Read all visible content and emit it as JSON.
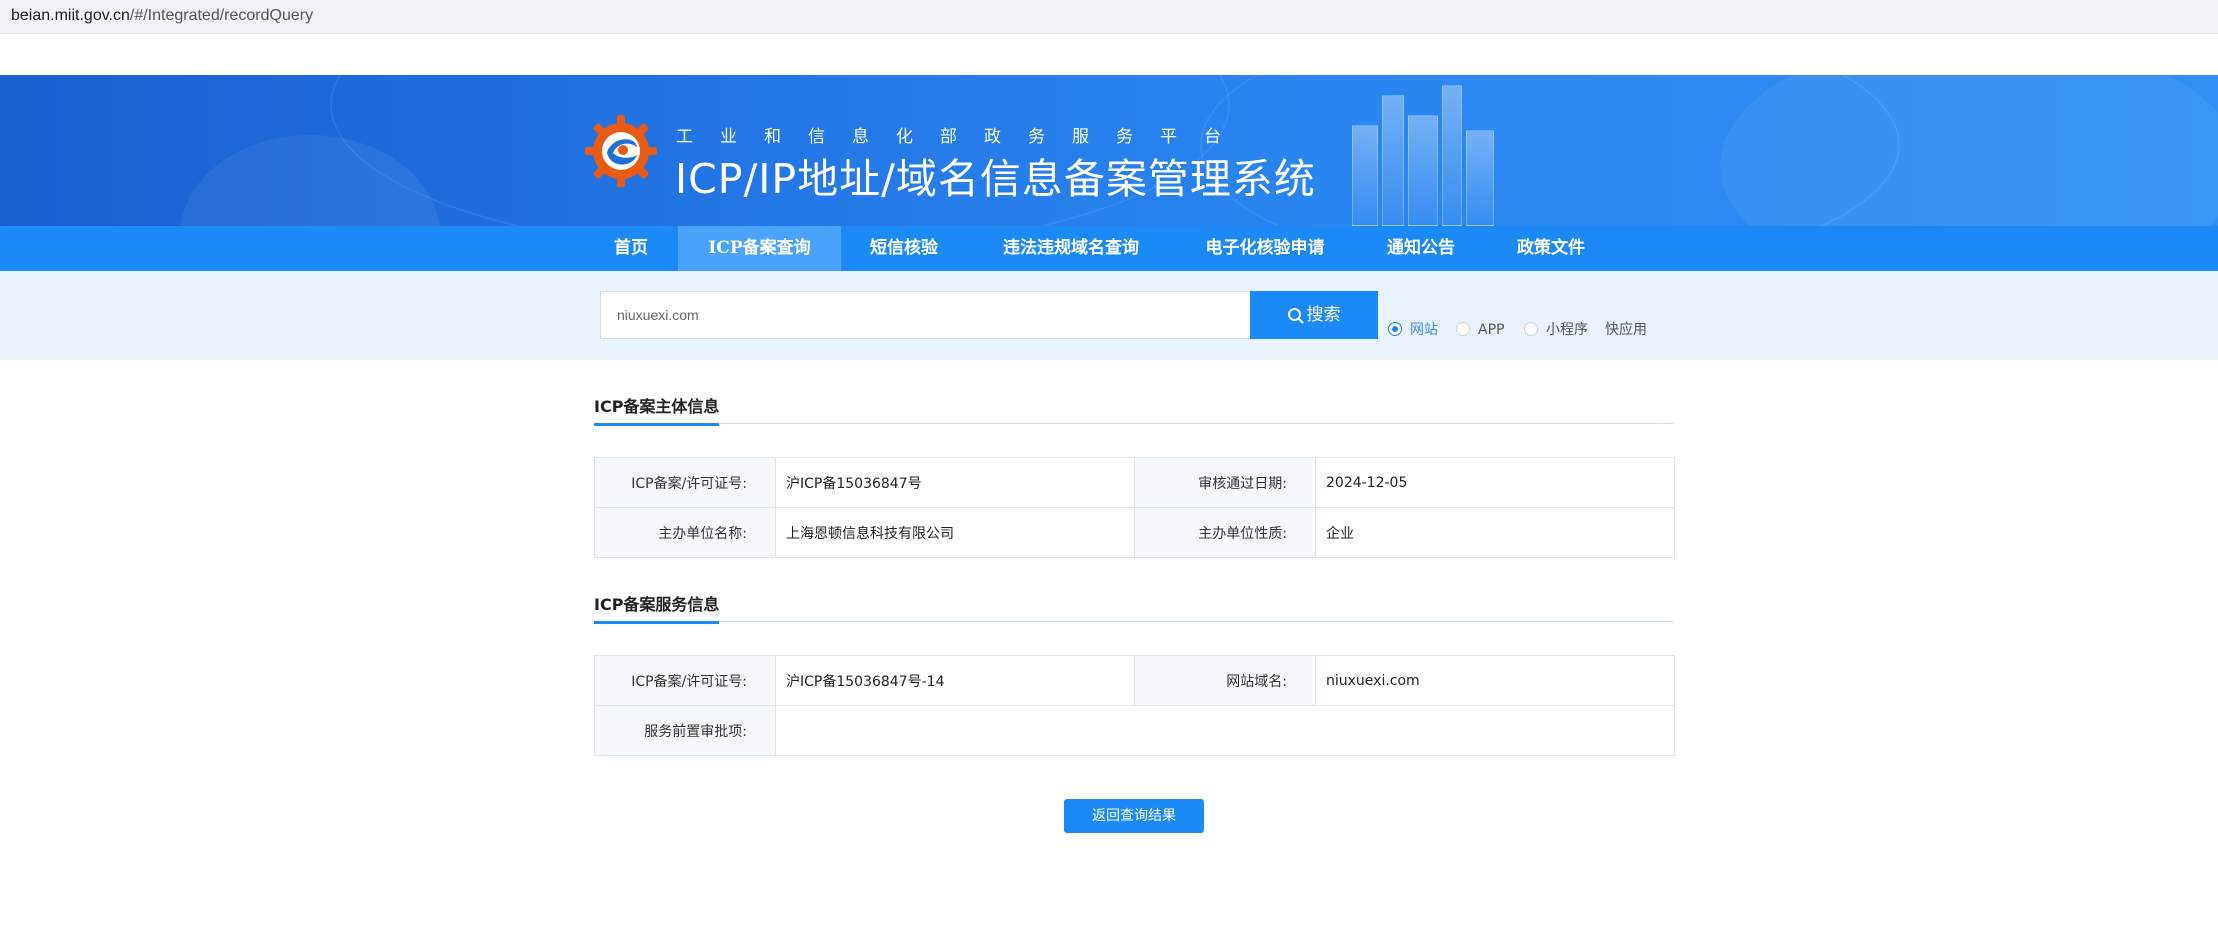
{
  "browser": {
    "url_host": "beian.miit.gov.cn",
    "url_path": "/#/Integrated/recordQuery"
  },
  "header": {
    "subtitle": "工业和信息化部政务服务平台",
    "title": "ICP/IP地址/域名信息备案管理系统",
    "logo_icon": "miit-gear-logo"
  },
  "nav": {
    "items": [
      {
        "label": "首页",
        "active": false
      },
      {
        "label": "ICP备案查询",
        "active": true
      },
      {
        "label": "短信核验",
        "active": false
      },
      {
        "label": "违法违规域名查询",
        "active": false
      },
      {
        "label": "电子化核验申请",
        "active": false
      },
      {
        "label": "通知公告",
        "active": false
      },
      {
        "label": "政策文件",
        "active": false
      }
    ]
  },
  "search": {
    "value": "niuxuexi.com",
    "button_label": "搜索",
    "search_icon": "search-icon",
    "types": [
      {
        "label": "网站",
        "checked": true
      },
      {
        "label": "APP",
        "checked": false
      },
      {
        "label": "小程序",
        "checked": false
      },
      {
        "label": "快应用",
        "checked": false
      }
    ]
  },
  "subject_info": {
    "heading": "ICP备案主体信息",
    "rows": [
      {
        "k1": "ICP备案/许可证号:",
        "v1": "沪ICP备15036847号",
        "k2": "审核通过日期:",
        "v2": "2024-12-05"
      },
      {
        "k1": "主办单位名称:",
        "v1": "上海恩顿信息科技有限公司",
        "k2": "主办单位性质:",
        "v2": "企业"
      }
    ]
  },
  "service_info": {
    "heading": "ICP备案服务信息",
    "rows": [
      {
        "k1": "ICP备案/许可证号:",
        "v1": "沪ICP备15036847号-14",
        "k2": "网站域名:",
        "v2": "niuxuexi.com"
      },
      {
        "k1": "服务前置审批项:",
        "v1": ""
      }
    ]
  },
  "back_button": "返回查询结果",
  "colors": {
    "primary": "#1b8af7",
    "nav_active": "#4aa3fa",
    "search_strip": "#e8f3fd",
    "key_cell": "#f5f9fd"
  }
}
